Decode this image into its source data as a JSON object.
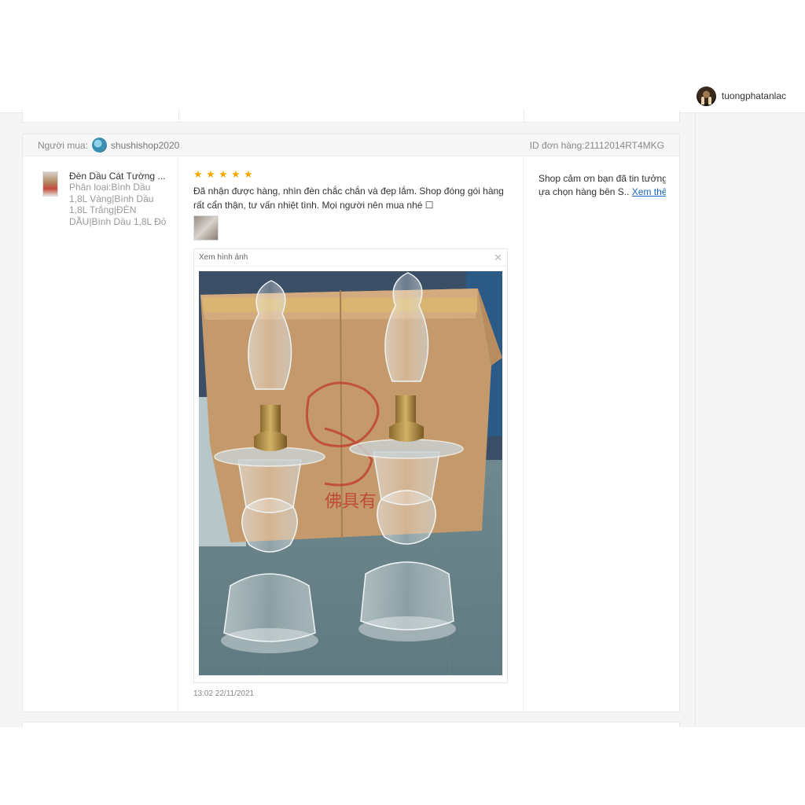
{
  "header": {
    "username": "tuongphatanlac"
  },
  "review": {
    "buyer_label": "Người mua:",
    "buyer_name": "shushishop2020",
    "order_id": "ID đơn hàng:21112014RT4MKG",
    "product_title": "Đèn Dầu Cát Tường ...",
    "product_variant": "Phân loại:Bình Dầu 1,8L Vàng|Bình Dầu 1,8L Trắng|ĐÈN DẦU|Bình Dầu 1,8L Đỏ",
    "rating": 5,
    "stars": [
      "★",
      "★",
      "★",
      "★",
      "★"
    ],
    "text": "Đã nhận được hàng, nhìn đèn chắc chắn và đẹp lắm. Shop đóng gói hàng rất cẩn thận, tư vấn nhiệt tình. Mọi người nên mua nhé ☐",
    "viewer_title": "Xem hình ảnh",
    "viewer_close": "✕",
    "time": "13:02 22/11/2021",
    "reply_line1": "Shop cảm ơn bạn đã tin tưởng l",
    "reply_line2": "ựa chọn hàng bên S..",
    "reply_see_more": "Xem thêm"
  },
  "colors": {
    "star": "#f6a700",
    "link": "#1a66c2",
    "page_bg": "#f5f5f5"
  }
}
